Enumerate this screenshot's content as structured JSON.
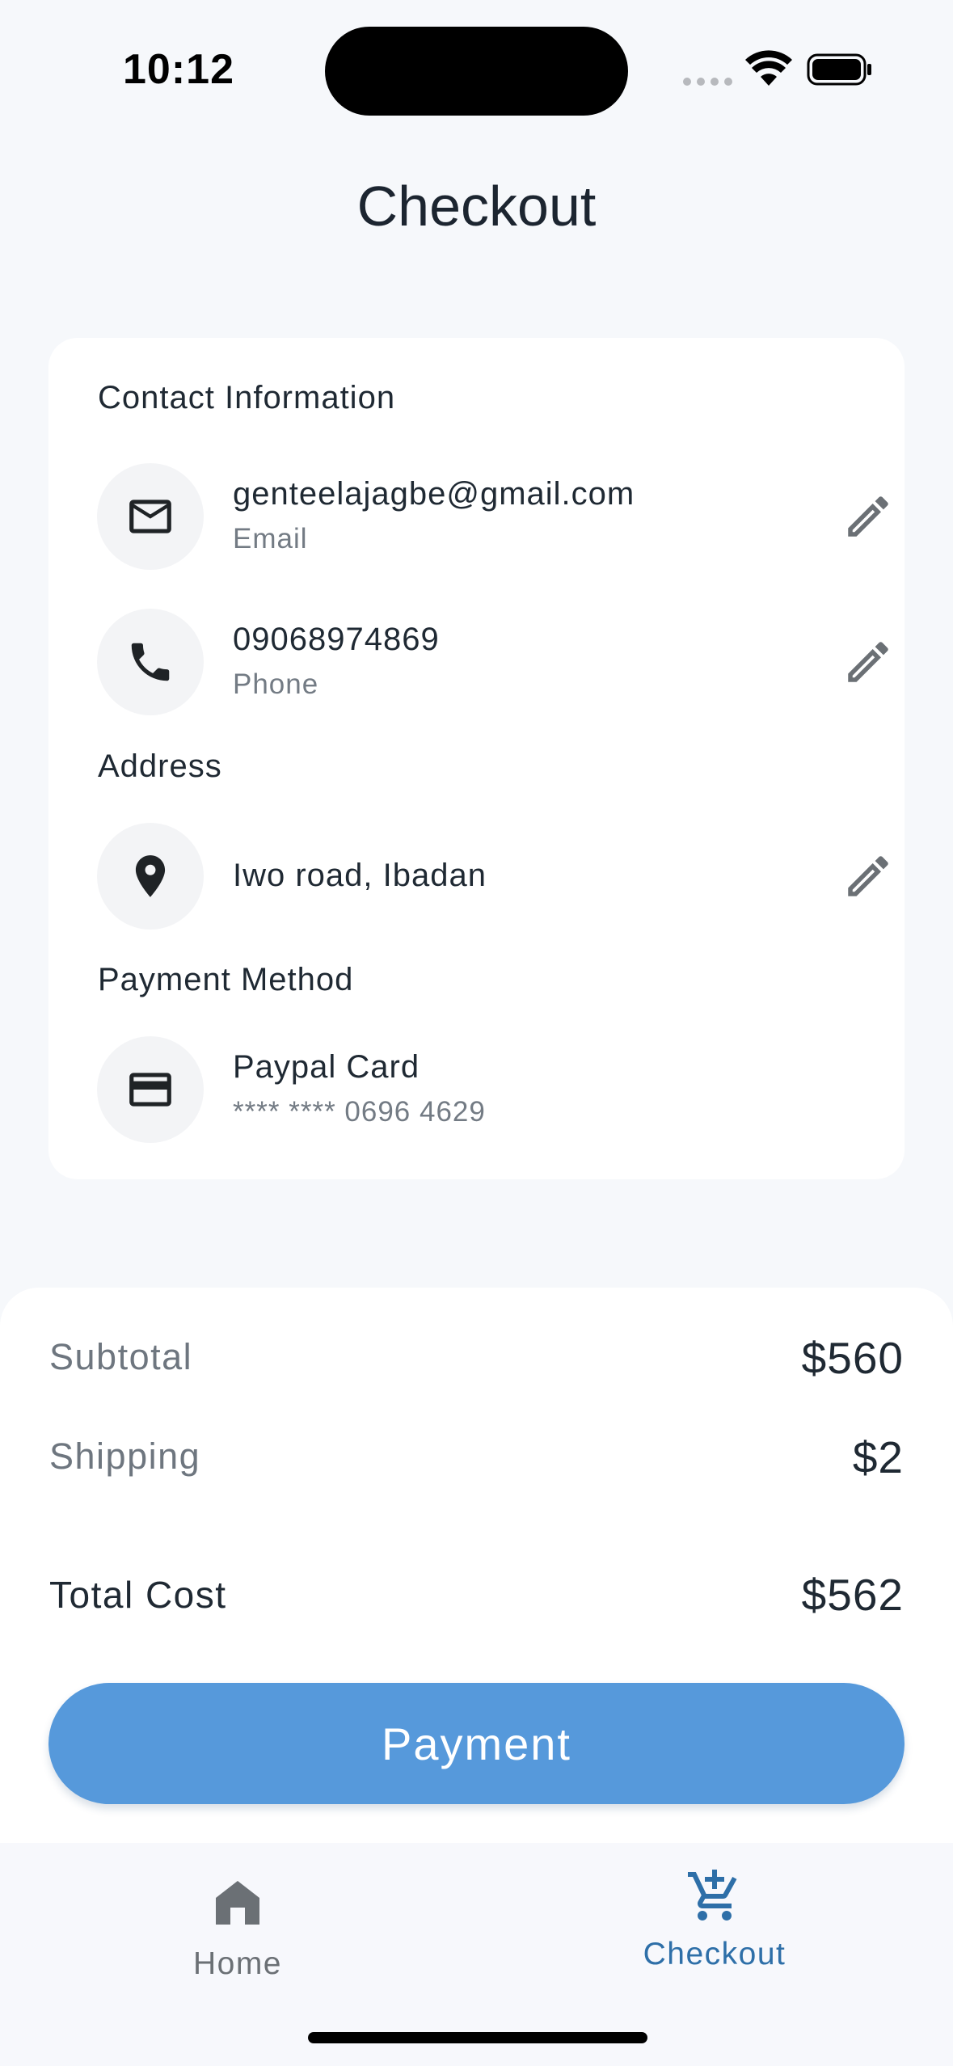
{
  "status_bar": {
    "time": "10:12"
  },
  "header": {
    "title": "Checkout"
  },
  "contact": {
    "section_title": "Contact Information",
    "email": {
      "value": "genteelajagbe@gmail.com",
      "label": "Email",
      "icon": "mail-icon"
    },
    "phone": {
      "value": "09068974869",
      "label": "Phone",
      "icon": "phone-icon"
    }
  },
  "address": {
    "section_title": "Address",
    "value": "Iwo road, Ibadan",
    "icon": "location-pin-icon"
  },
  "payment_method": {
    "section_title": "Payment Method",
    "name": "Paypal Card",
    "number": "**** **** 0696 4629",
    "icon": "credit-card-icon"
  },
  "summary": {
    "subtotal_label": "Subtotal",
    "subtotal_value": "$560",
    "shipping_label": "Shipping",
    "shipping_value": "$2",
    "total_label": "Total Cost",
    "total_value": "$562"
  },
  "payment_button": {
    "label": "Payment"
  },
  "bottom_nav": {
    "items": [
      {
        "label": "Home",
        "icon": "home-icon",
        "active": false
      },
      {
        "label": "Checkout",
        "icon": "cart-add-icon",
        "active": true
      }
    ]
  },
  "colors": {
    "accent": "#5699db",
    "active_nav": "#2e6fa8",
    "inactive_nav": "#6b7075",
    "background": "#f6f8fb",
    "card": "#ffffff"
  }
}
